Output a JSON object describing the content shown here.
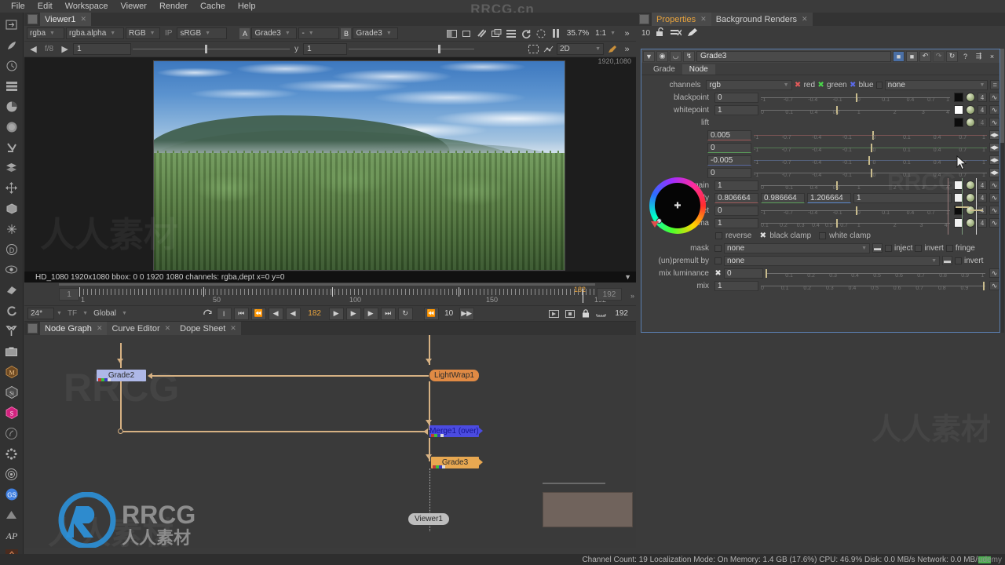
{
  "menu": {
    "items": [
      "File",
      "Edit",
      "Workspace",
      "Viewer",
      "Render",
      "Cache",
      "Help"
    ]
  },
  "watermarks": {
    "top": "RRCG.cn",
    "brand": "RRCG",
    "brand_cn": "人人素材",
    "udemy": "udemy"
  },
  "viewer": {
    "tab_label": "Viewer1",
    "controls": {
      "channel": "rgba",
      "channel_alpha": "rgba.alpha",
      "display": "RGB",
      "ip": "IP",
      "colorspace": "sRGB",
      "a_label": "A",
      "a_value": "Grade3",
      "compare": "-",
      "b_label": "B",
      "b_value": "Grade3",
      "zoom": "35.7%",
      "ratio": "1:1",
      "gain_arrow_left": "◀",
      "gain_label": "f/8",
      "gain_arrow_right": "▶",
      "gain_value": "1",
      "gamma_label": "y",
      "gamma_value": "1",
      "mode_2d": "2D"
    },
    "resolution_overlay": "1920,1080",
    "status": "HD_1080 1920x1080  bbox: 0 0 1920 1080 channels: rgba,dept  x=0 y=0"
  },
  "timeline": {
    "start_box": "1",
    "end_box": "192",
    "labels": [
      "1",
      "50",
      "100",
      "150",
      "192"
    ],
    "playhead_frame": "182",
    "fps": "24*",
    "tf": "TF",
    "scope": "Global",
    "current_frame": "182",
    "step": "10",
    "range_end": "192"
  },
  "node_graph": {
    "tabs": [
      {
        "label": "Node Graph",
        "active": true
      },
      {
        "label": "Curve Editor",
        "active": false
      },
      {
        "label": "Dope Sheet",
        "active": false
      }
    ],
    "nodes": [
      {
        "name": "Grade2",
        "color": "#aeb8e8",
        "text": "#1b2160"
      },
      {
        "name": "LightWrap1",
        "color": "#e08a44",
        "text": "#3a1a05"
      },
      {
        "name": "Merge1 (over)",
        "color": "#4b4be0",
        "text": "#111188"
      },
      {
        "name": "Grade3",
        "color": "#e8a851",
        "text": "#3a2405"
      },
      {
        "name": "Viewer1",
        "color": "#bdbdbd",
        "text": "#2b2b2b"
      }
    ]
  },
  "properties": {
    "tabs": [
      {
        "label": "Properties",
        "active": true
      },
      {
        "label": "Background Renders",
        "active": false
      }
    ],
    "toolbar": {
      "count": "10"
    },
    "node": {
      "name": "Grade3",
      "tabs": [
        {
          "label": "Grade",
          "active": true
        },
        {
          "label": "Node",
          "active": false
        }
      ],
      "help_glyph": "?",
      "close_glyph": "×"
    },
    "channels": {
      "label": "channels",
      "value": "rgb",
      "red": "red",
      "green": "green",
      "blue": "blue",
      "extra": "none"
    },
    "rows": [
      {
        "label": "blackpoint",
        "value": "0",
        "swatch": "#0c0c0c",
        "num": "4"
      },
      {
        "label": "whitepoint",
        "value": "1",
        "swatch": "#ffffff",
        "num": "4"
      },
      {
        "label": "lift",
        "value": "",
        "swatch": "#0c0c0c",
        "num": "4"
      }
    ],
    "lift_channels": [
      {
        "value": "0.005",
        "accent": "#a05a5a"
      },
      {
        "value": "0",
        "accent": "#5aa05a"
      },
      {
        "value": "-0.005",
        "accent": "#5a6aa0"
      },
      {
        "value": "0",
        "accent": "#888888"
      }
    ],
    "rows2": [
      {
        "label": "gain",
        "value": "1",
        "swatch": "#f2f2f2",
        "num": "4"
      },
      {
        "label": "offset",
        "value": "0",
        "swatch": "#0c0c0c",
        "num": "4"
      },
      {
        "label": "gamma",
        "value": "1",
        "swatch": "#f2f2f2",
        "num": "4"
      }
    ],
    "multiply": {
      "label": "multiply",
      "values": [
        "0.806664",
        "0.986664",
        "1.206664",
        "1"
      ],
      "swatch": "#f0f0f0",
      "num": "4"
    },
    "clamps": [
      {
        "label": "reverse",
        "checked": false
      },
      {
        "label": "black clamp",
        "checked": true
      },
      {
        "label": "white clamp",
        "checked": false
      }
    ],
    "mask": {
      "label": "mask",
      "value": "none",
      "inject": "inject",
      "invert": "invert",
      "fringe": "fringe"
    },
    "premult": {
      "label": "(un)premult by",
      "value": "none",
      "invert": "invert"
    },
    "mix_luminance": {
      "label": "mix luminance",
      "value": "0",
      "checked": true
    },
    "mix": {
      "label": "mix",
      "value": "1"
    }
  },
  "statusbar": {
    "text": "Channel Count: 19  Localization Mode: On  Memory: 1.4 GB (17.6%)  CPU: 46.9%  Disk: 0.0 MB/s  Network: 0.0 MB/s"
  },
  "colors": {
    "accent_orange": "#e8a33d",
    "panel_bg": "#3b3b3b",
    "panel_dark": "#323232",
    "selection_blue": "#5b7fb0"
  }
}
